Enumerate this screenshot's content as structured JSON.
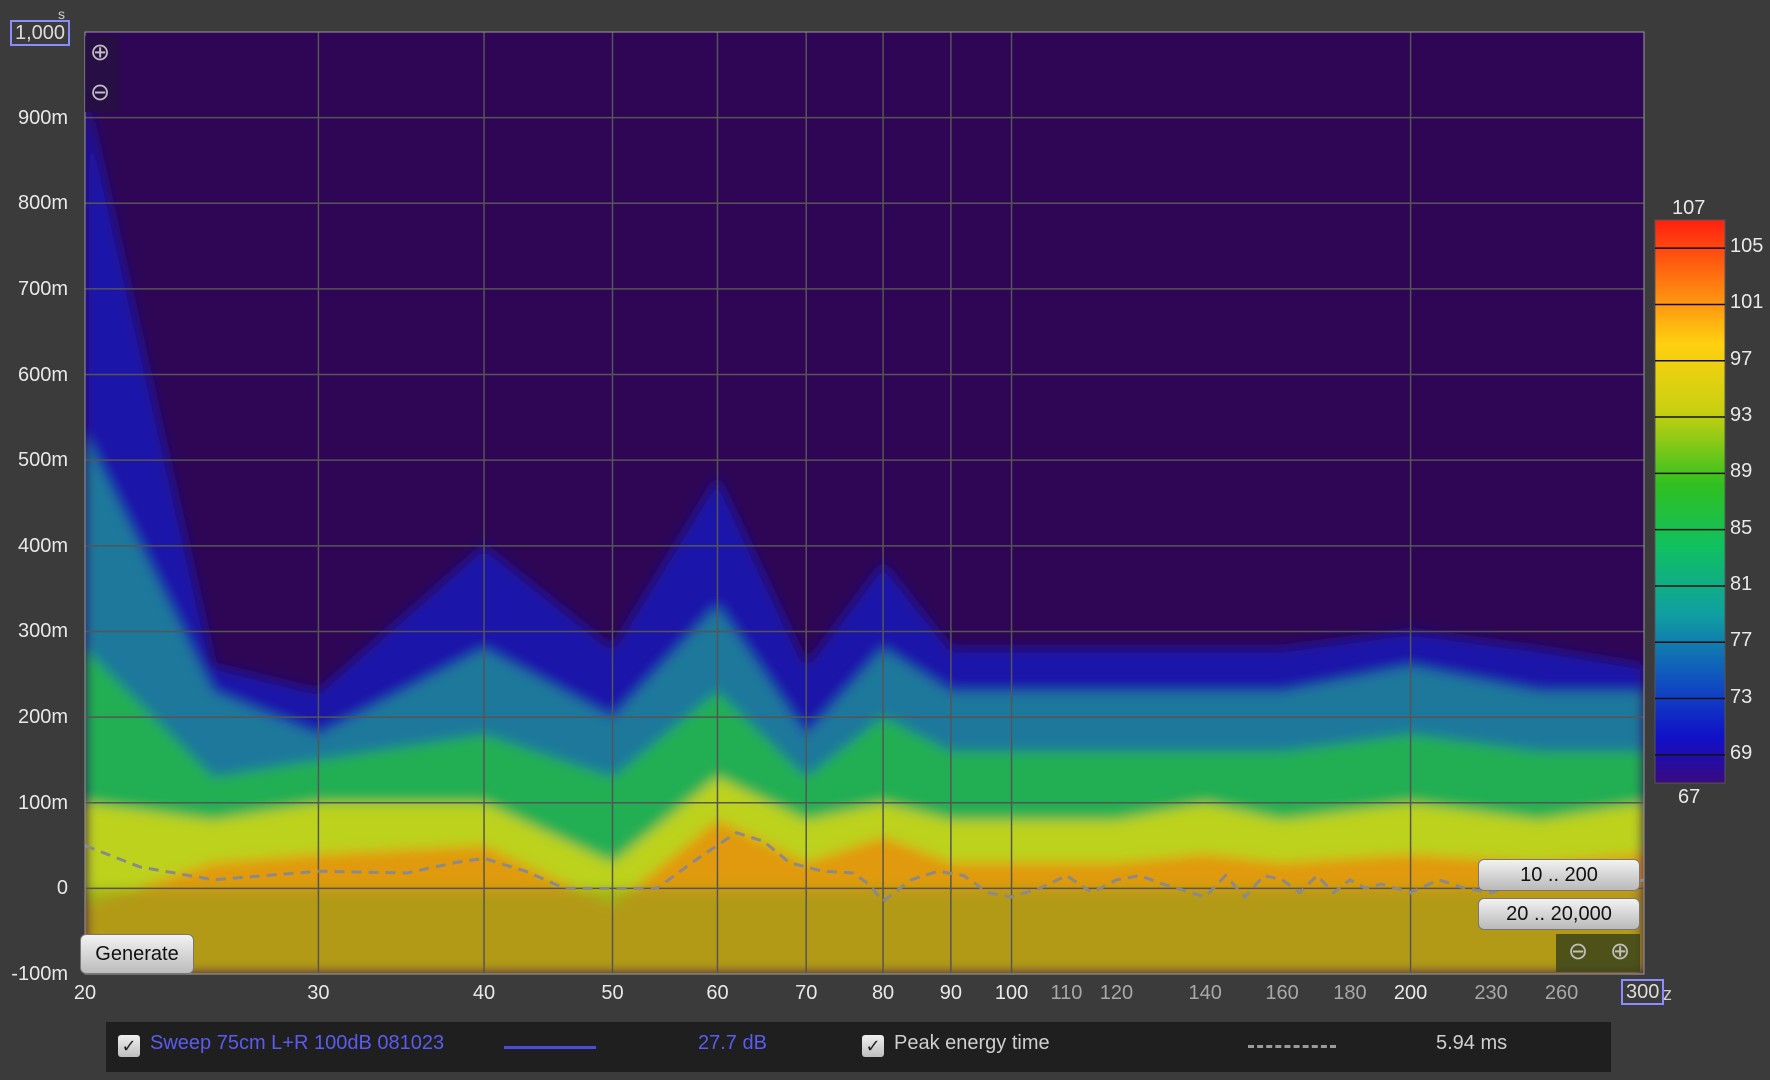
{
  "chart_data": {
    "type": "heatmap",
    "title": "",
    "xlabel": "",
    "ylabel": "",
    "x_scale": "log",
    "xlim": [
      20,
      300
    ],
    "ylim": [
      -0.1,
      1.0
    ],
    "x_ticks": [
      "20",
      "30",
      "40",
      "50",
      "60",
      "70",
      "80",
      "90",
      "100",
      "110",
      "120",
      "140",
      "160",
      "180",
      "200",
      "230",
      "260",
      "3"
    ],
    "x_minor_ticks": [
      "110",
      "120",
      "140",
      "160",
      "180",
      "230",
      "260"
    ],
    "y_ticks": [
      "900m",
      "800m",
      "700m",
      "600m",
      "500m",
      "400m",
      "300m",
      "200m",
      "100m",
      "0",
      "-100m"
    ],
    "y_top_label": "1,000",
    "x_right_label": "300",
    "x_unit_suffix": "z",
    "y_unit_fragment": "s",
    "colorbar": {
      "top_label": "107",
      "bottom_label": "67",
      "ticks": [
        "105",
        "101",
        "97",
        "93",
        "89",
        "85",
        "81",
        "77",
        "73",
        "69"
      ]
    },
    "series": [
      {
        "name": "Peak energy time",
        "style": "dashed",
        "x": [
          20,
          22,
          25,
          30,
          35,
          38,
          40,
          43,
          46,
          50,
          54,
          58,
          62,
          65,
          68,
          72,
          76,
          78,
          80,
          84,
          88,
          92,
          96,
          100,
          105,
          110,
          115,
          120,
          125,
          130,
          140,
          145,
          150,
          155,
          160,
          165,
          170,
          175,
          180,
          185,
          190,
          200,
          210,
          220,
          230,
          240,
          250,
          260,
          270,
          280,
          290,
          300
        ],
        "y": [
          0.05,
          0.025,
          0.01,
          0.02,
          0.018,
          0.03,
          0.035,
          0.02,
          0.0,
          0.0,
          0.0,
          0.035,
          0.065,
          0.055,
          0.03,
          0.02,
          0.018,
          0.005,
          -0.015,
          0.01,
          0.02,
          0.015,
          -0.005,
          -0.01,
          0.0,
          0.015,
          -0.005,
          0.01,
          0.015,
          0.005,
          -0.01,
          0.015,
          -0.01,
          0.015,
          0.01,
          -0.005,
          0.015,
          -0.005,
          0.01,
          0.0,
          0.005,
          -0.005,
          0.01,
          0.0,
          -0.005,
          0.005,
          0.01,
          0.0,
          0.005,
          0.0,
          0.005,
          0.01
        ]
      }
    ]
  },
  "buttons": {
    "generate": "Generate",
    "range_time": "10 .. 200",
    "range_freq": "20 .. 20,000"
  },
  "legend": {
    "measurement_name": "Sweep 75cm L+R 100dB 081023",
    "measurement_value": "27.7 dB",
    "peak_label": "Peak energy time",
    "peak_value": "5.94 ms",
    "measurement_color": "#4b4bdc",
    "check_glyph": "✓"
  },
  "icons": {
    "zoom_in": "⊕",
    "zoom_out": "⊖"
  }
}
